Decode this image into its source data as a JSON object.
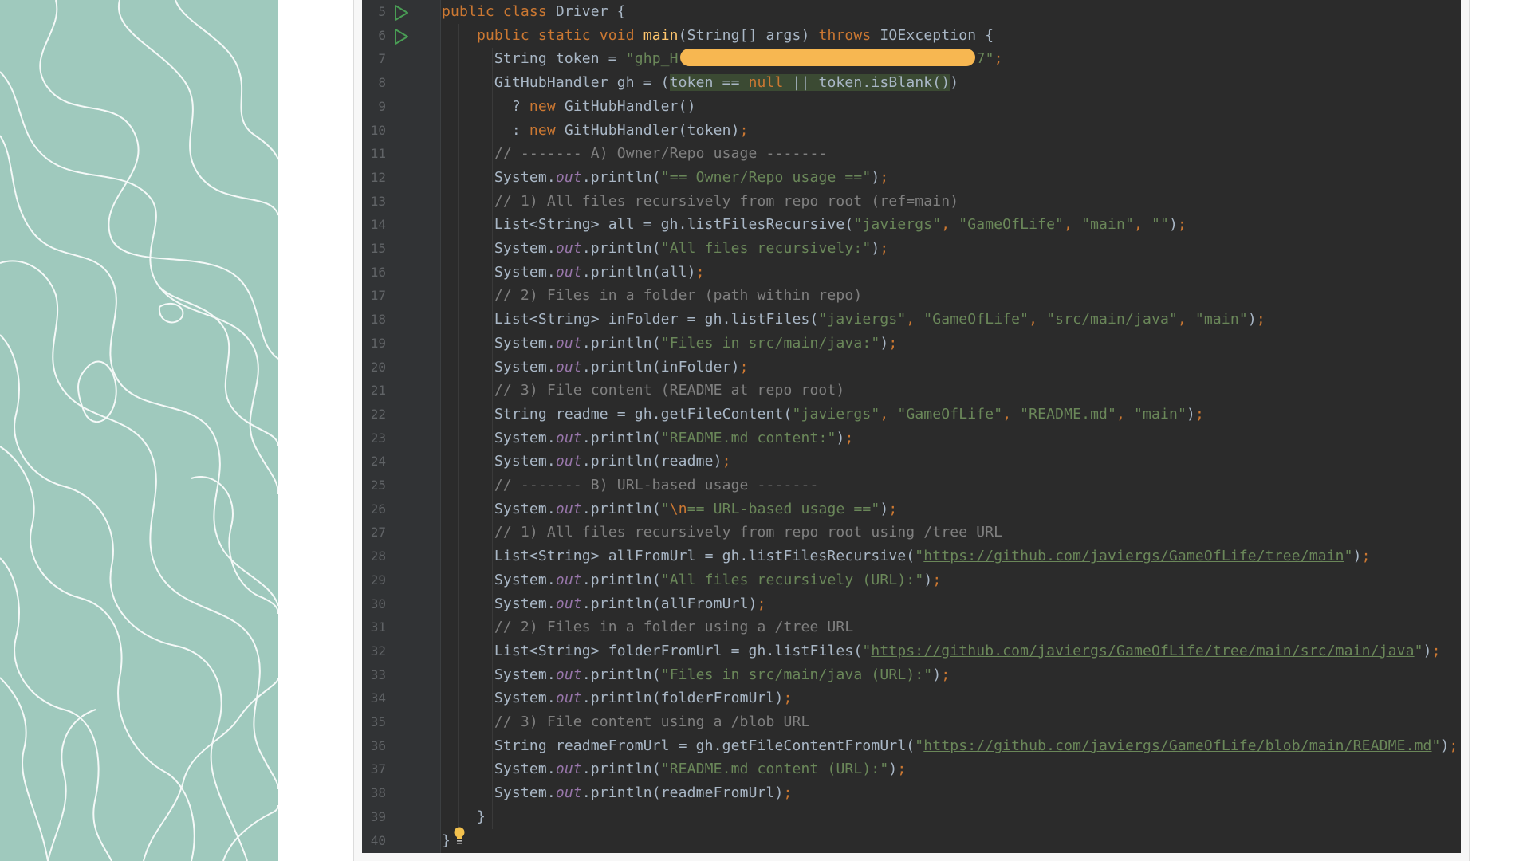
{
  "editor": {
    "lines": [
      {
        "n": "5",
        "tokens": [
          [
            "kw",
            "public class "
          ],
          [
            "t",
            "Driver {"
          ]
        ]
      },
      {
        "n": "6",
        "tokens": [
          [
            "t",
            "    "
          ],
          [
            "kw",
            "public static void "
          ],
          [
            "fn",
            "main"
          ],
          [
            "t",
            "(String[] args) "
          ],
          [
            "kw",
            "throws "
          ],
          [
            "t",
            "IOException {"
          ]
        ]
      },
      {
        "n": "7",
        "tokens": [
          [
            "t",
            "      String token = "
          ],
          [
            "str",
            "\"ghp_H"
          ],
          [
            "redact",
            ""
          ],
          [
            "str",
            "7\""
          ],
          [
            "kw",
            ";"
          ]
        ]
      },
      {
        "n": "8",
        "tokens": [
          [
            "t",
            "      GitHubHandler gh = ("
          ],
          [
            "hl",
            "token == "
          ],
          [
            "hlkw",
            "null"
          ],
          [
            "hl",
            " || token.isBlank()"
          ],
          [
            "t",
            ")"
          ]
        ]
      },
      {
        "n": "9",
        "tokens": [
          [
            "t",
            "        ? "
          ],
          [
            "kw",
            "new "
          ],
          [
            "t",
            "GitHubHandler()"
          ]
        ]
      },
      {
        "n": "10",
        "tokens": [
          [
            "t",
            "        : "
          ],
          [
            "kw",
            "new "
          ],
          [
            "t",
            "GitHubHandler(token)"
          ],
          [
            "kw",
            ";"
          ]
        ]
      },
      {
        "n": "11",
        "tokens": [
          [
            "cm",
            "      // ------- A) Owner/Repo usage -------"
          ]
        ]
      },
      {
        "n": "12",
        "tokens": [
          [
            "t",
            "      System."
          ],
          [
            "fld",
            "out"
          ],
          [
            "t",
            ".println("
          ],
          [
            "str",
            "\"== Owner/Repo usage ==\""
          ],
          [
            "t",
            ")"
          ],
          [
            "kw",
            ";"
          ]
        ]
      },
      {
        "n": "13",
        "tokens": [
          [
            "cm",
            "      // 1) All files recursively from repo root (ref=main)"
          ]
        ]
      },
      {
        "n": "14",
        "tokens": [
          [
            "t",
            "      List<String> all = gh.listFilesRecursive("
          ],
          [
            "str",
            "\"javiergs\""
          ],
          [
            "kw",
            ", "
          ],
          [
            "str",
            "\"GameOfLife\""
          ],
          [
            "kw",
            ", "
          ],
          [
            "str",
            "\"main\""
          ],
          [
            "kw",
            ", "
          ],
          [
            "str",
            "\"\""
          ],
          [
            "t",
            ")"
          ],
          [
            "kw",
            ";"
          ]
        ]
      },
      {
        "n": "15",
        "tokens": [
          [
            "t",
            "      System."
          ],
          [
            "fld",
            "out"
          ],
          [
            "t",
            ".println("
          ],
          [
            "str",
            "\"All files recursively:\""
          ],
          [
            "t",
            ")"
          ],
          [
            "kw",
            ";"
          ]
        ]
      },
      {
        "n": "16",
        "tokens": [
          [
            "t",
            "      System."
          ],
          [
            "fld",
            "out"
          ],
          [
            "t",
            ".println(all)"
          ],
          [
            "kw",
            ";"
          ]
        ]
      },
      {
        "n": "17",
        "tokens": [
          [
            "cm",
            "      // 2) Files in a folder (path within repo)"
          ]
        ]
      },
      {
        "n": "18",
        "tokens": [
          [
            "t",
            "      List<String> inFolder = gh.listFiles("
          ],
          [
            "str",
            "\"javiergs\""
          ],
          [
            "kw",
            ", "
          ],
          [
            "str",
            "\"GameOfLife\""
          ],
          [
            "kw",
            ", "
          ],
          [
            "str",
            "\"src/main/java\""
          ],
          [
            "kw",
            ", "
          ],
          [
            "str",
            "\"main\""
          ],
          [
            "t",
            ")"
          ],
          [
            "kw",
            ";"
          ]
        ]
      },
      {
        "n": "19",
        "tokens": [
          [
            "t",
            "      System."
          ],
          [
            "fld",
            "out"
          ],
          [
            "t",
            ".println("
          ],
          [
            "str",
            "\"Files in src/main/java:\""
          ],
          [
            "t",
            ")"
          ],
          [
            "kw",
            ";"
          ]
        ]
      },
      {
        "n": "20",
        "tokens": [
          [
            "t",
            "      System."
          ],
          [
            "fld",
            "out"
          ],
          [
            "t",
            ".println(inFolder)"
          ],
          [
            "kw",
            ";"
          ]
        ]
      },
      {
        "n": "21",
        "tokens": [
          [
            "cm",
            "      // 3) File content (README at repo root)"
          ]
        ]
      },
      {
        "n": "22",
        "tokens": [
          [
            "t",
            "      String readme = gh.getFileContent("
          ],
          [
            "str",
            "\"javiergs\""
          ],
          [
            "kw",
            ", "
          ],
          [
            "str",
            "\"GameOfLife\""
          ],
          [
            "kw",
            ", "
          ],
          [
            "str",
            "\"README.md\""
          ],
          [
            "kw",
            ", "
          ],
          [
            "str",
            "\"main\""
          ],
          [
            "t",
            ")"
          ],
          [
            "kw",
            ";"
          ]
        ]
      },
      {
        "n": "23",
        "tokens": [
          [
            "t",
            "      System."
          ],
          [
            "fld",
            "out"
          ],
          [
            "t",
            ".println("
          ],
          [
            "str",
            "\"README.md content:\""
          ],
          [
            "t",
            ")"
          ],
          [
            "kw",
            ";"
          ]
        ]
      },
      {
        "n": "24",
        "tokens": [
          [
            "t",
            "      System."
          ],
          [
            "fld",
            "out"
          ],
          [
            "t",
            ".println(readme)"
          ],
          [
            "kw",
            ";"
          ]
        ]
      },
      {
        "n": "25",
        "tokens": [
          [
            "cm",
            "      // ------- B) URL-based usage -------"
          ]
        ]
      },
      {
        "n": "26",
        "tokens": [
          [
            "t",
            "      System."
          ],
          [
            "fld",
            "out"
          ],
          [
            "t",
            ".println("
          ],
          [
            "str",
            "\""
          ],
          [
            "esc",
            "\\n"
          ],
          [
            "str",
            "== URL-based usage ==\""
          ],
          [
            "t",
            ")"
          ],
          [
            "kw",
            ";"
          ]
        ]
      },
      {
        "n": "27",
        "tokens": [
          [
            "cm",
            "      // 1) All files recursively from repo root using /tree URL"
          ]
        ]
      },
      {
        "n": "28",
        "tokens": [
          [
            "t",
            "      List<String> allFromUrl = gh.listFilesRecursive("
          ],
          [
            "str",
            "\""
          ],
          [
            "url",
            "https://github.com/javiergs/GameOfLife/tree/main"
          ],
          [
            "str",
            "\""
          ],
          [
            "t",
            ")"
          ],
          [
            "kw",
            ";"
          ]
        ]
      },
      {
        "n": "29",
        "tokens": [
          [
            "t",
            "      System."
          ],
          [
            "fld",
            "out"
          ],
          [
            "t",
            ".println("
          ],
          [
            "str",
            "\"All files recursively (URL):\""
          ],
          [
            "t",
            ")"
          ],
          [
            "kw",
            ";"
          ]
        ]
      },
      {
        "n": "30",
        "tokens": [
          [
            "t",
            "      System."
          ],
          [
            "fld",
            "out"
          ],
          [
            "t",
            ".println(allFromUrl)"
          ],
          [
            "kw",
            ";"
          ]
        ]
      },
      {
        "n": "31",
        "tokens": [
          [
            "cm",
            "      // 2) Files in a folder using a /tree URL"
          ]
        ]
      },
      {
        "n": "32",
        "tokens": [
          [
            "t",
            "      List<String> folderFromUrl = gh.listFiles("
          ],
          [
            "str",
            "\""
          ],
          [
            "url",
            "https://github.com/javiergs/GameOfLife/tree/main/src/main/java"
          ],
          [
            "str",
            "\""
          ],
          [
            "t",
            ")"
          ],
          [
            "kw",
            ";"
          ]
        ]
      },
      {
        "n": "33",
        "tokens": [
          [
            "t",
            "      System."
          ],
          [
            "fld",
            "out"
          ],
          [
            "t",
            ".println("
          ],
          [
            "str",
            "\"Files in src/main/java (URL):\""
          ],
          [
            "t",
            ")"
          ],
          [
            "kw",
            ";"
          ]
        ]
      },
      {
        "n": "34",
        "tokens": [
          [
            "t",
            "      System."
          ],
          [
            "fld",
            "out"
          ],
          [
            "t",
            ".println(folderFromUrl)"
          ],
          [
            "kw",
            ";"
          ]
        ]
      },
      {
        "n": "35",
        "tokens": [
          [
            "cm",
            "      // 3) File content using a /blob URL"
          ]
        ]
      },
      {
        "n": "36",
        "tokens": [
          [
            "t",
            "      String readmeFromUrl = gh.getFileContentFromUrl("
          ],
          [
            "str",
            "\""
          ],
          [
            "url",
            "https://github.com/javiergs/GameOfLife/blob/main/README.md"
          ],
          [
            "str",
            "\""
          ],
          [
            "t",
            ")"
          ],
          [
            "kw",
            ";"
          ]
        ]
      },
      {
        "n": "37",
        "tokens": [
          [
            "t",
            "      System."
          ],
          [
            "fld",
            "out"
          ],
          [
            "t",
            ".println("
          ],
          [
            "str",
            "\"README.md content (URL):\""
          ],
          [
            "t",
            ")"
          ],
          [
            "kw",
            ";"
          ]
        ]
      },
      {
        "n": "38",
        "tokens": [
          [
            "t",
            "      System."
          ],
          [
            "fld",
            "out"
          ],
          [
            "t",
            ".println(readmeFromUrl)"
          ],
          [
            "kw",
            ";"
          ]
        ]
      },
      {
        "n": "39",
        "tokens": [
          [
            "t",
            "    }"
          ]
        ]
      },
      {
        "n": "40",
        "tokens": [
          [
            "t",
            "}"
          ]
        ]
      }
    ],
    "run_lines": [
      "5",
      "6"
    ],
    "colors": {
      "background": "#2b2b2b",
      "keyword": "#cc7832",
      "string": "#6a8759",
      "comment": "#808080",
      "method": "#ffc66d",
      "field": "#9876aa",
      "run_icon": "#499c54",
      "redaction": "#f7b751",
      "side_panel": "#9fc9bd"
    },
    "icons": {
      "run": "run-gutter-icon",
      "bulb": "lightbulb-icon"
    }
  }
}
